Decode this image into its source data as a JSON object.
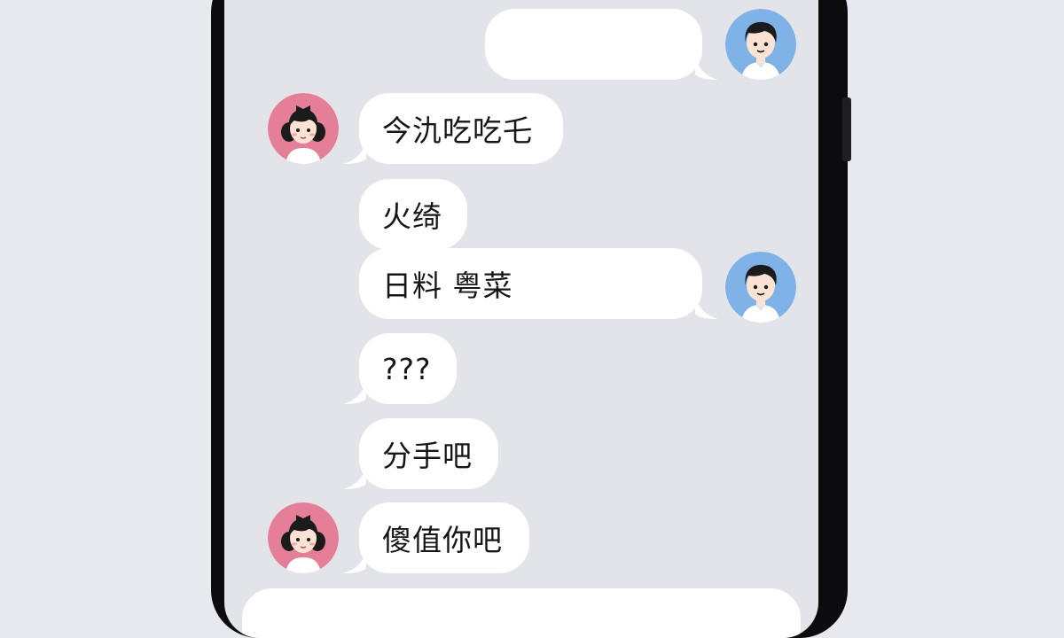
{
  "conversation": {
    "messages": [
      {
        "sender": "boy",
        "text": ""
      },
      {
        "sender": "girl",
        "text": "今氿吃吃乇"
      },
      {
        "sender": "girl",
        "text": "火绮"
      },
      {
        "sender": "boy",
        "text": "日料 粤菜"
      },
      {
        "sender": "girl",
        "text": "???"
      },
      {
        "sender": "girl",
        "text": "分手吧"
      },
      {
        "sender": "girl",
        "text": "傻值你吧"
      },
      {
        "sender": "boy",
        "text": ""
      }
    ]
  },
  "colors": {
    "background": "#e8e9ee",
    "screen": "#e3e4ea",
    "bubble": "#ffffff",
    "boy_avatar": "#7fb2e6",
    "girl_avatar": "#e57f97"
  },
  "icons": {
    "boy_avatar": "boy-avatar-icon",
    "girl_avatar": "girl-avatar-icon"
  }
}
